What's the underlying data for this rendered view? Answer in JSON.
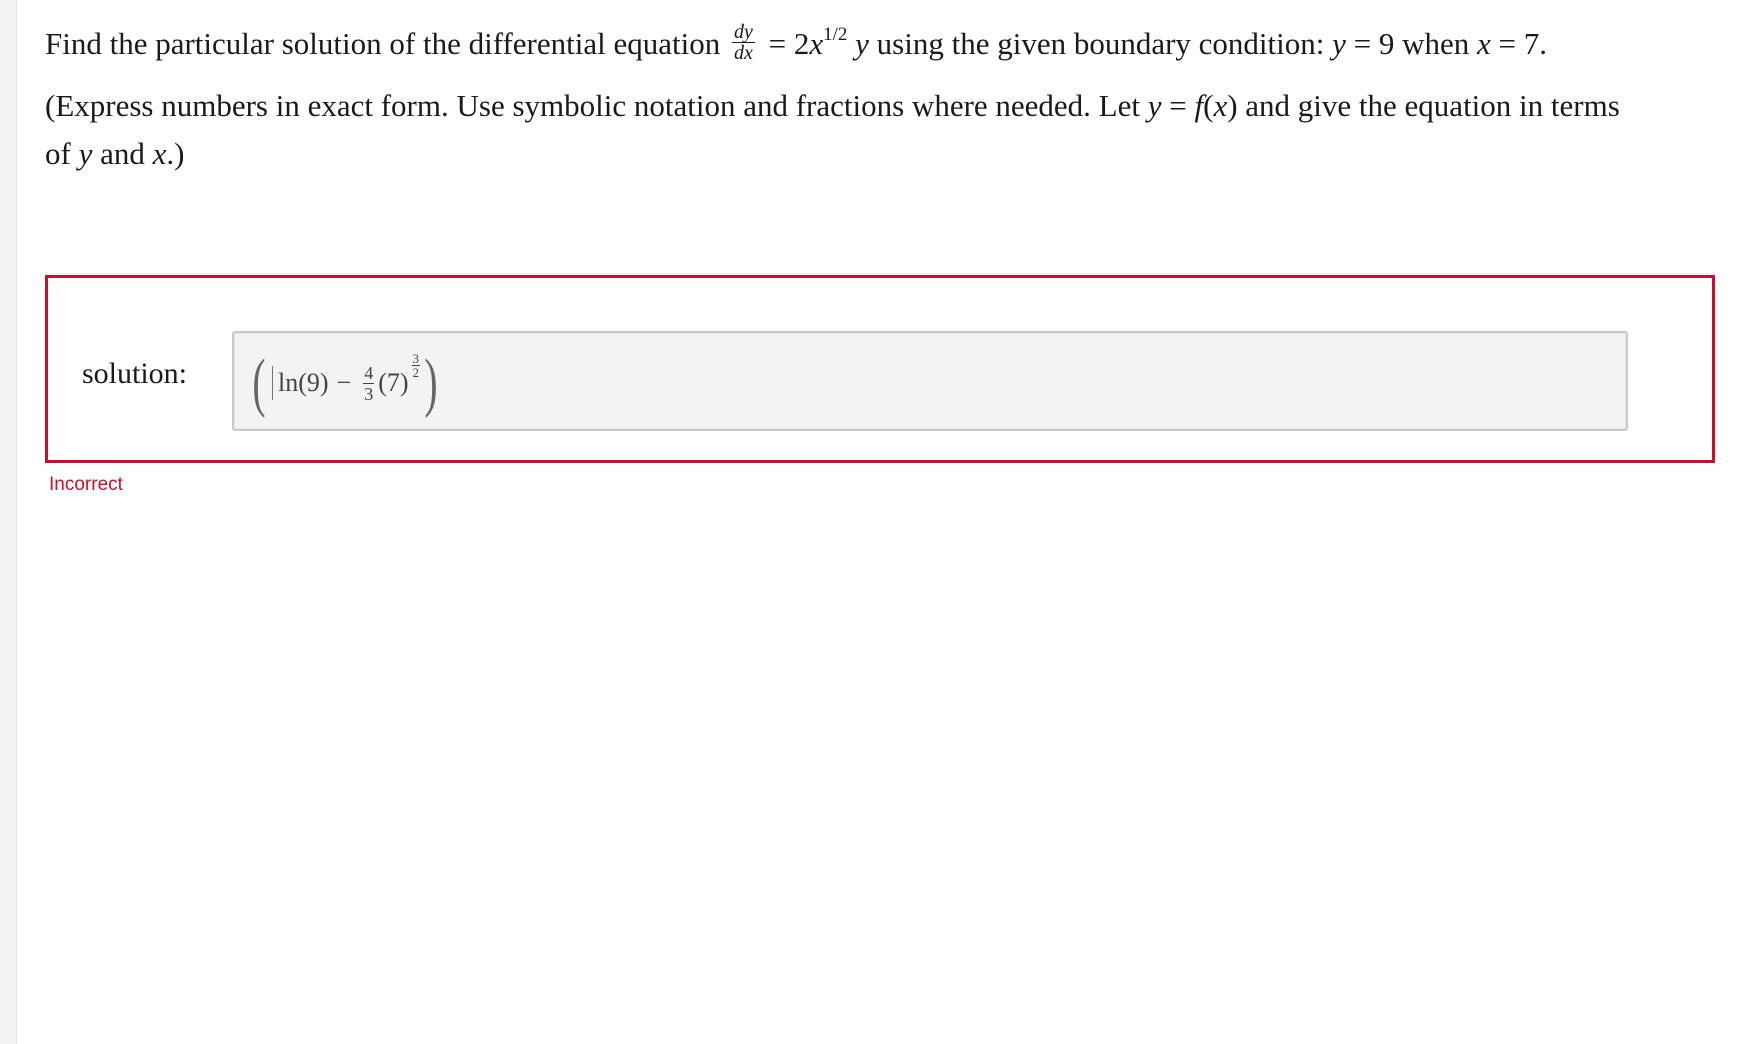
{
  "question": {
    "line1_prefix": "Find the particular solution of the differential equation",
    "deriv_num": "dy",
    "deriv_den": "dx",
    "eq_rhs_a": "= 2",
    "eq_rhs_x": "x",
    "exponent": "1/2",
    "eq_rhs_y": "y",
    "line1_mid": "using the given boundary condition:",
    "cond_y": "y",
    "cond_eq1": "= 9 when",
    "cond_x": "x",
    "cond_eq2": "= 7.",
    "instr_a": "(Express numbers in exact form. Use symbolic notation and fractions where needed. Let",
    "instr_y": "y",
    "instr_eq": "=",
    "instr_f": "f",
    "instr_fx_open": "(",
    "instr_fx_x": "x",
    "instr_fx_close": ")",
    "instr_b": "and give the equation in terms",
    "instr_c": "of",
    "instr_c_y": "y",
    "instr_c_and": "and",
    "instr_c_x": "x",
    "instr_c_end": ".)"
  },
  "answer": {
    "label": "solution:",
    "open_paren": "(",
    "close_paren": ")",
    "ln": "ln(9)",
    "minus": "−",
    "coef_num": "4",
    "coef_den": "3",
    "base": "(7)",
    "exp_num": "3",
    "exp_den": "2",
    "status": "Incorrect",
    "status_color": "#c8102e"
  }
}
